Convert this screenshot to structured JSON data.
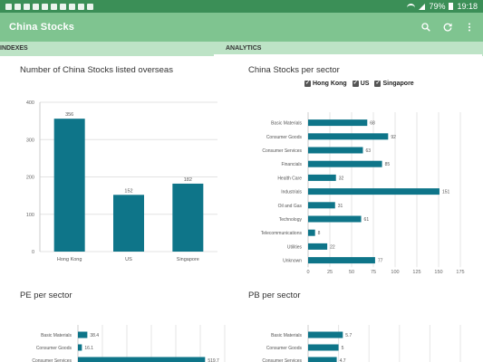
{
  "status_bar": {
    "battery": "79%",
    "time": "19:18",
    "icons": [
      "notification-icon",
      "notification-icon",
      "notification-icon",
      "notification-icon",
      "notification-icon",
      "notification-icon",
      "notification-icon",
      "notification-icon",
      "notification-icon",
      "notification-icon"
    ]
  },
  "app_bar": {
    "title": "China Stocks",
    "actions": [
      "search-icon",
      "refresh-icon",
      "more-vert-icon"
    ]
  },
  "tabs": [
    {
      "label": "INDEXES",
      "selected": false
    },
    {
      "label": "ANALYTICS",
      "selected": true
    }
  ],
  "panels": {
    "listed_overseas": {
      "title": "Number of China Stocks listed overseas"
    },
    "per_sector": {
      "title": "China Stocks per sector"
    },
    "pe_sector": {
      "title": "PE per sector"
    },
    "pb_sector": {
      "title": "PB per sector"
    }
  },
  "legend": [
    {
      "label": "Hong Kong",
      "checked": true
    },
    {
      "label": "US",
      "checked": true
    },
    {
      "label": "Singapore",
      "checked": true
    }
  ],
  "colors": {
    "bar": "#0e7589",
    "status_bar": "#3b8f57",
    "app_bar": "#7fc490",
    "tab_strip": "#bde3c6"
  },
  "chart_data": [
    {
      "type": "bar",
      "title": "Number of China Stocks listed overseas",
      "categories": [
        "Hong Kong",
        "US",
        "Singapore"
      ],
      "values": [
        356,
        152,
        182
      ],
      "yticks": [
        0,
        100,
        200,
        300,
        400
      ],
      "ylim": [
        0,
        400
      ],
      "grid": true
    },
    {
      "type": "bar",
      "orientation": "horizontal",
      "title": "China Stocks per sector",
      "categories": [
        "Basic Materials",
        "Consumer Goods",
        "Consumer Services",
        "Financials",
        "Health Care",
        "Industrials",
        "Oil and Gas",
        "Technology",
        "Telecommunications",
        "Utilities",
        "Unknown"
      ],
      "values": [
        68,
        92,
        63,
        85,
        32,
        151,
        31,
        61,
        8,
        22,
        77
      ],
      "xticks": [
        0,
        25,
        50,
        75,
        100,
        125,
        150,
        175
      ],
      "xlim": [
        0,
        175
      ],
      "grid": true
    },
    {
      "type": "bar",
      "orientation": "horizontal",
      "title": "PE per sector",
      "categories": [
        "Basic Materials",
        "Consumer Goods",
        "Consumer Services"
      ],
      "values": [
        38.4,
        16.1,
        519.7
      ],
      "grid": true
    },
    {
      "type": "bar",
      "orientation": "horizontal",
      "title": "PB per sector",
      "categories": [
        "Basic Materials",
        "Consumer Goods",
        "Consumer Services"
      ],
      "values": [
        5.7,
        5,
        4.7
      ],
      "grid": true
    }
  ]
}
